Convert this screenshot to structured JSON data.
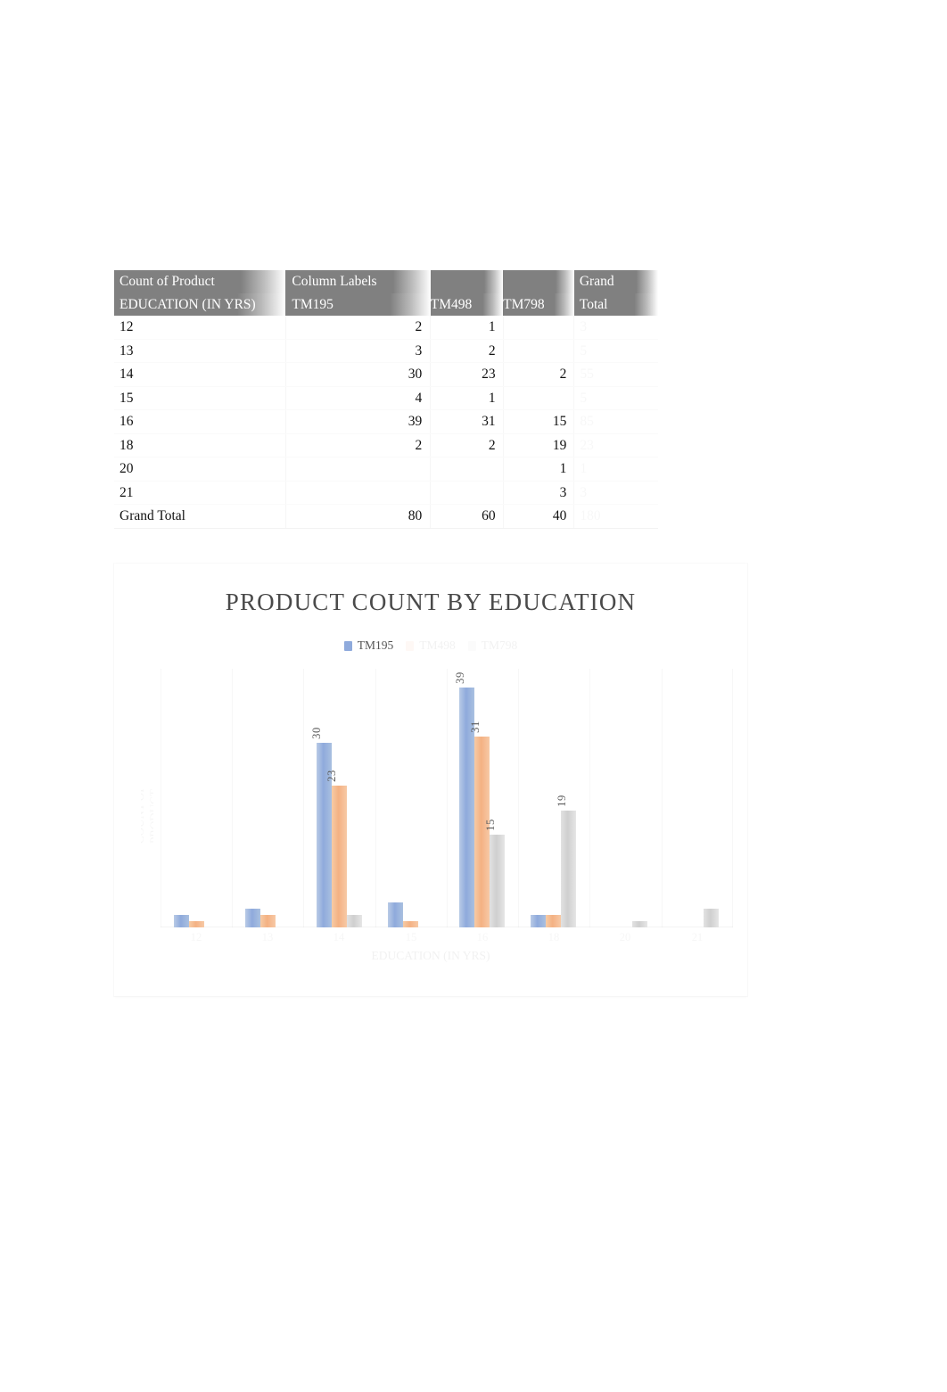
{
  "pivot": {
    "corner_label": "Count of Product",
    "column_labels_header": "Column Labels",
    "row_field_header": "EDUCATION (IN YRS)",
    "columns": [
      "TM195",
      "TM498",
      "TM798"
    ],
    "grand_total_header_line1": "Grand",
    "grand_total_header_line2": "Total",
    "header_bg": "#808080",
    "rows": [
      {
        "education": "12",
        "TM195": "2",
        "TM498": "1",
        "TM798": "",
        "grand_total": "3"
      },
      {
        "education": "13",
        "TM195": "3",
        "TM498": "2",
        "TM798": "",
        "grand_total": "5"
      },
      {
        "education": "14",
        "TM195": "30",
        "TM498": "23",
        "TM798": "2",
        "grand_total": "55"
      },
      {
        "education": "15",
        "TM195": "4",
        "TM498": "1",
        "TM798": "",
        "grand_total": "5"
      },
      {
        "education": "16",
        "TM195": "39",
        "TM498": "31",
        "TM798": "15",
        "grand_total": "85"
      },
      {
        "education": "18",
        "TM195": "2",
        "TM498": "2",
        "TM798": "19",
        "grand_total": "23"
      },
      {
        "education": "20",
        "TM195": "",
        "TM498": "",
        "TM798": "1",
        "grand_total": "1"
      },
      {
        "education": "21",
        "TM195": "",
        "TM498": "",
        "TM798": "3",
        "grand_total": "3"
      }
    ],
    "total_row": {
      "education": "Grand Total",
      "TM195": "80",
      "TM498": "60",
      "TM798": "40",
      "grand_total": "180"
    }
  },
  "chart": {
    "title": "PRODUCT COUNT BY EDUCATION",
    "legend": [
      {
        "label": "TM195",
        "color": "#8faadc",
        "visible": true
      },
      {
        "label": "TM498",
        "color": "#f4b183",
        "visible": false
      },
      {
        "label": "TM798",
        "color": "#cfcfcf",
        "visible": false
      }
    ],
    "x_axis_title": "EDUCATION (IN YRS)",
    "y_axis_title": "COUNT OF PRODUCT"
  },
  "chart_data": {
    "type": "bar",
    "title": "PRODUCT COUNT BY EDUCATION",
    "xlabel": "EDUCATION (IN YRS)",
    "ylabel": "COUNT OF PRODUCT",
    "categories": [
      "12",
      "13",
      "14",
      "15",
      "16",
      "18",
      "20",
      "21"
    ],
    "ylim": [
      0,
      42
    ],
    "grid": false,
    "legend_position": "top",
    "series": [
      {
        "name": "TM195",
        "color": "#8faadc",
        "values": [
          2,
          3,
          30,
          4,
          39,
          2,
          0,
          0
        ]
      },
      {
        "name": "TM498",
        "color": "#f4b183",
        "values": [
          1,
          2,
          23,
          1,
          31,
          2,
          0,
          0
        ]
      },
      {
        "name": "TM798",
        "color": "#cfcfcf",
        "values": [
          0,
          0,
          2,
          0,
          15,
          19,
          1,
          3
        ]
      }
    ],
    "data_labels_shown": [
      "30",
      "23",
      "39",
      "31",
      "15",
      "19"
    ]
  }
}
